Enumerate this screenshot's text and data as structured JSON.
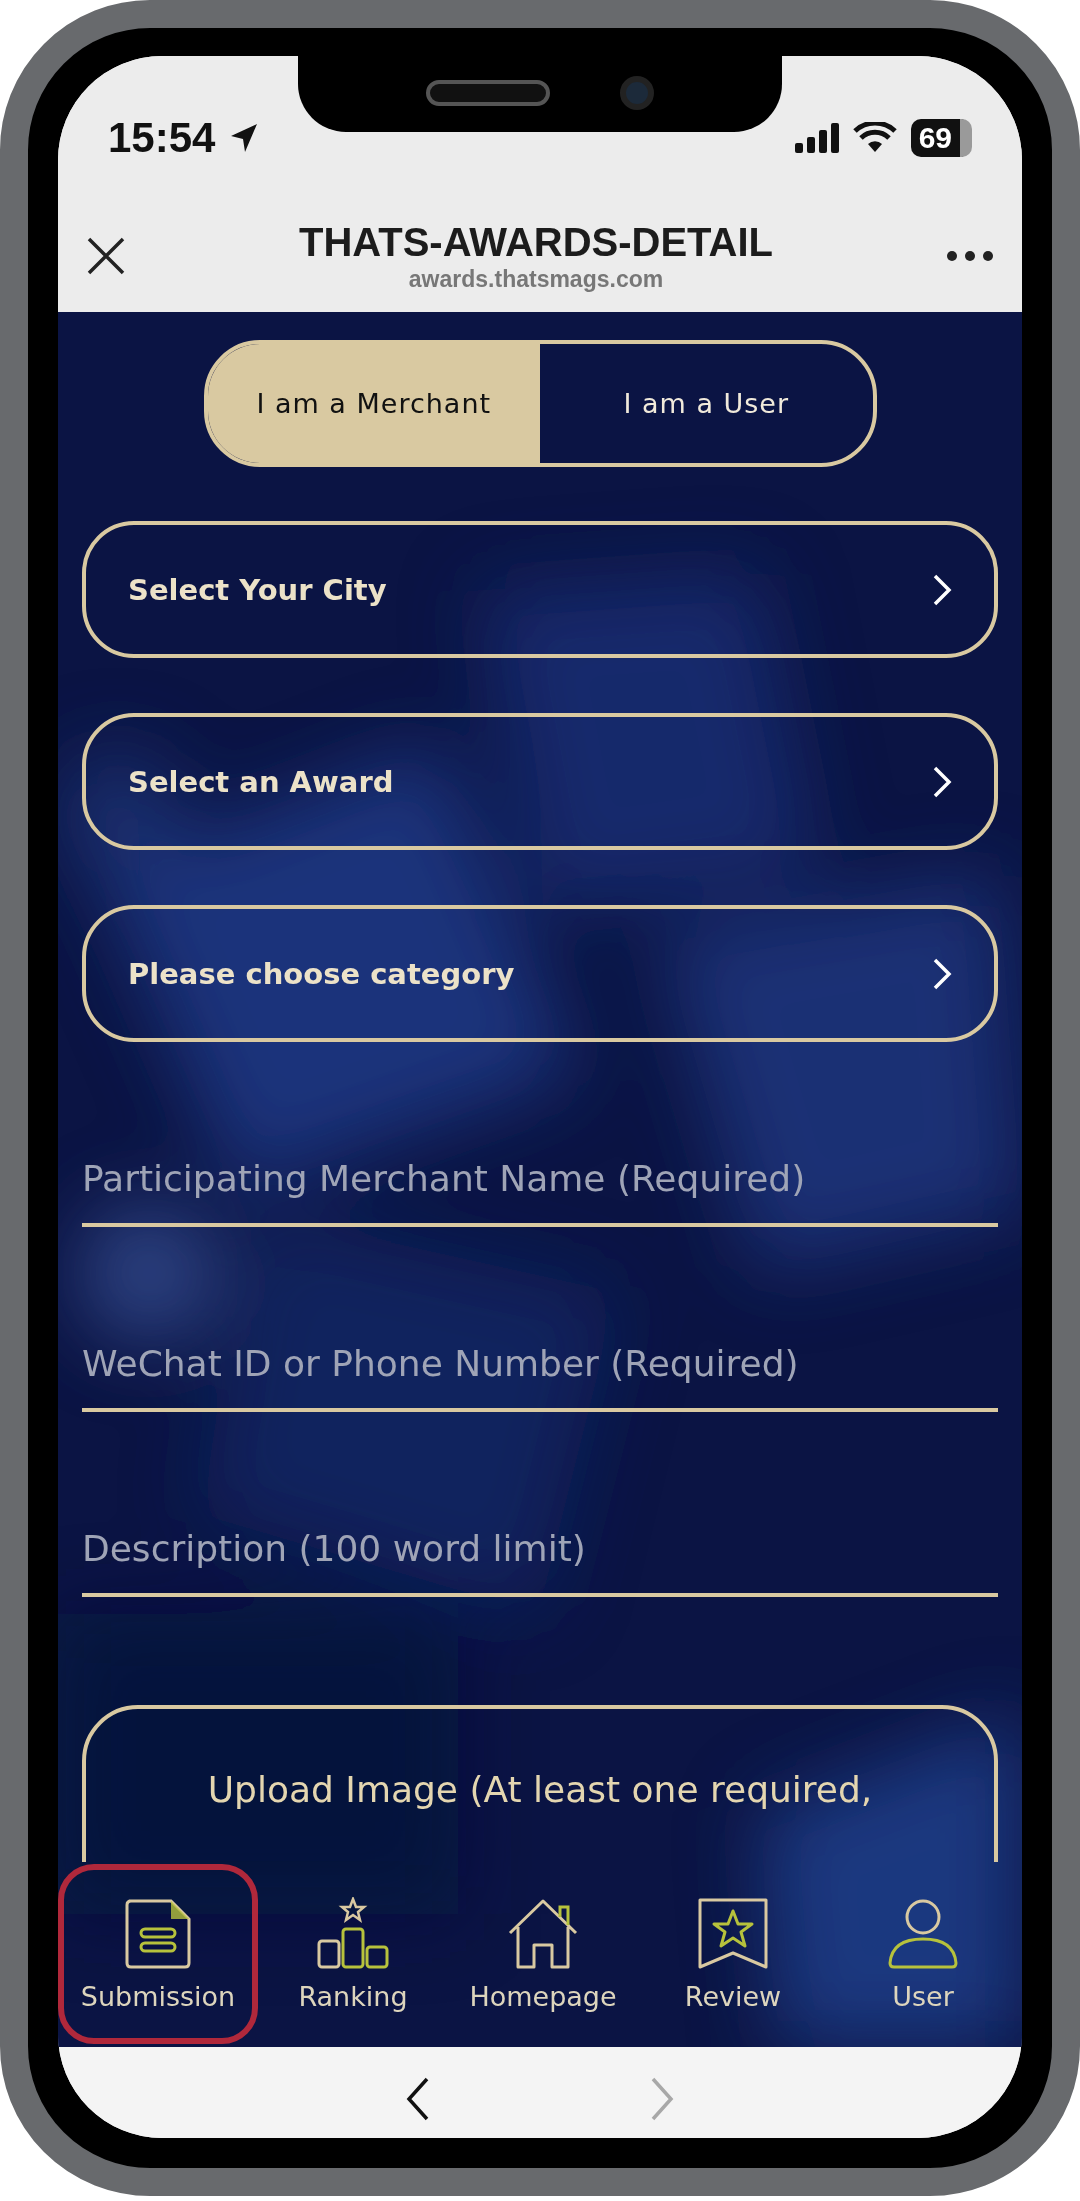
{
  "status_bar": {
    "time": "15:54",
    "battery": "69"
  },
  "browser": {
    "title": "THATS-AWARDS-DETAIL",
    "url": "awards.thatsmags.com"
  },
  "role_toggle": [
    {
      "label": "I am a Merchant",
      "selected": true
    },
    {
      "label": "I am a User",
      "selected": false
    }
  ],
  "selects": [
    {
      "label": "Select Your City"
    },
    {
      "label": "Select an Award"
    },
    {
      "label": "Please choose category"
    }
  ],
  "fields": [
    {
      "placeholder": "Participating Merchant Name (Required)"
    },
    {
      "placeholder": "WeChat ID or Phone Number (Required)"
    },
    {
      "placeholder": "Description (100 word limit)"
    }
  ],
  "upload": {
    "label": "Upload Image (At least one required,"
  },
  "tab_bar": [
    {
      "label": "Submission",
      "kind": "document",
      "highlighted": true
    },
    {
      "label": "Ranking",
      "kind": "podium",
      "highlighted": false
    },
    {
      "label": "Homepage",
      "kind": "house",
      "highlighted": false
    },
    {
      "label": "Review",
      "kind": "bookmark",
      "highlighted": false
    },
    {
      "label": "User",
      "kind": "person",
      "highlighted": false
    }
  ],
  "toolbar": {
    "back_disabled": false,
    "forward_disabled": true
  }
}
